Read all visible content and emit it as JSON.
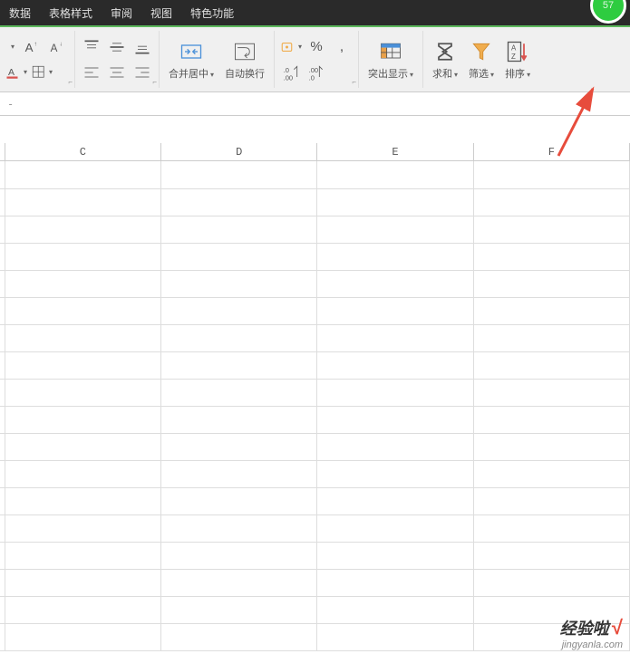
{
  "menubar": {
    "items": [
      "数据",
      "表格样式",
      "审阅",
      "视图",
      "特色功能"
    ],
    "badge": "57"
  },
  "ribbon": {
    "merge_label": "合并居中",
    "wrap_label": "自动换行",
    "highlight_label": "突出显示",
    "sum_label": "求和",
    "filter_label": "筛选",
    "sort_label": "排序",
    "percent": "%"
  },
  "formula_bar": {
    "value": "-"
  },
  "columns": [
    "C",
    "D",
    "E",
    "F"
  ],
  "watermark": {
    "main": "经验啦",
    "sub": "jingyanla.com"
  }
}
